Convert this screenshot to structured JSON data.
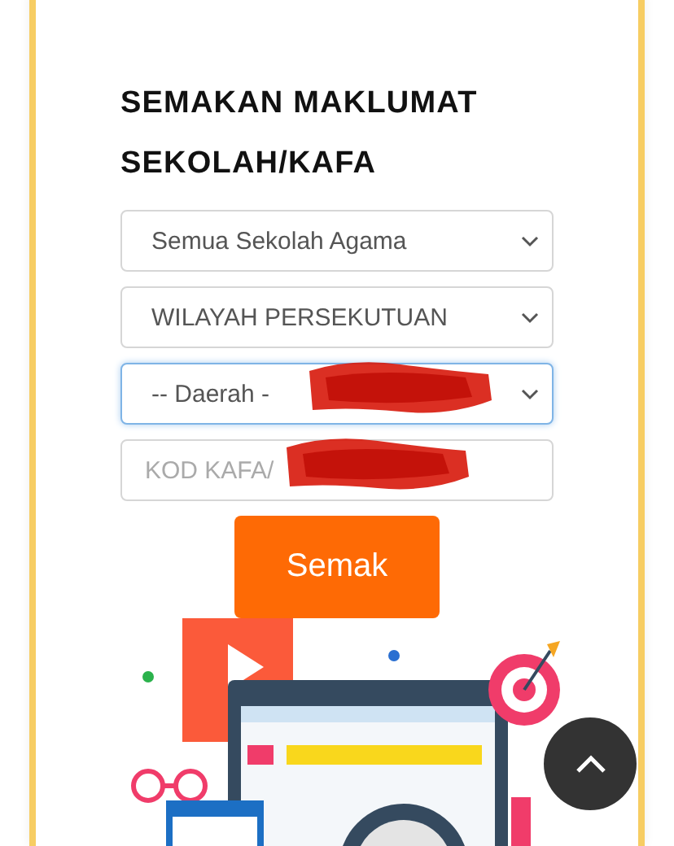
{
  "form": {
    "title": "SEMAKAN MAKLUMAT SEKOLAH/KAFA",
    "fields": [
      {
        "kind": "select",
        "value": "Semua Sekolah Agama",
        "focused": false,
        "redacted": false
      },
      {
        "kind": "select",
        "value": "WILAYAH PERSEKUTUAN",
        "focused": false,
        "redacted": false
      },
      {
        "kind": "select",
        "value": "-- Daerah -",
        "focused": true,
        "redacted": true
      },
      {
        "kind": "input",
        "placeholder": "KOD KAFA/",
        "focused": false,
        "redacted": true
      }
    ],
    "button": "Semak"
  }
}
